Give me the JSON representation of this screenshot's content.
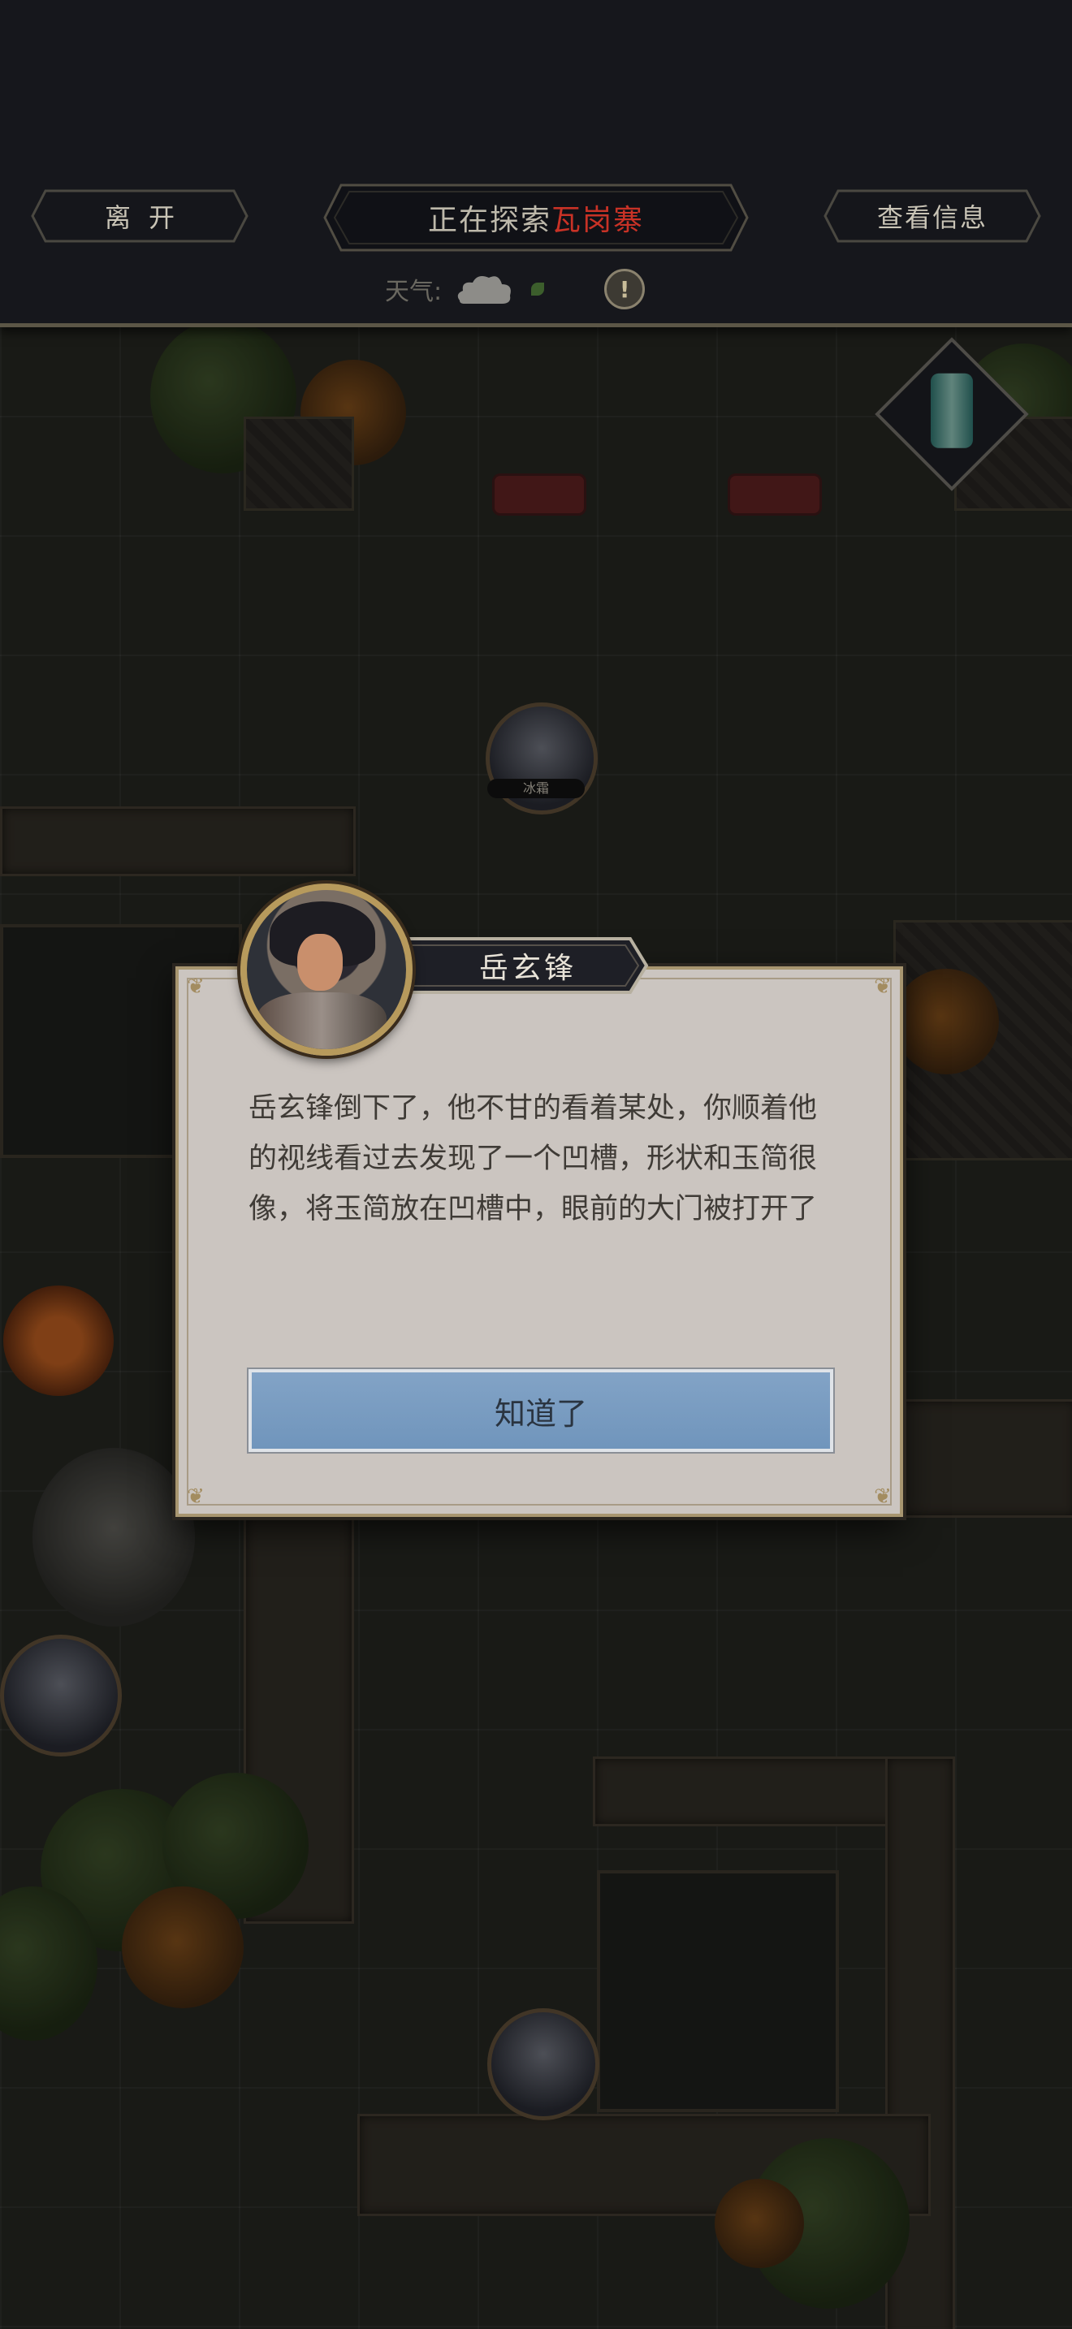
{
  "topbar": {
    "leave_label": "离开",
    "explore_prefix": "正在探索",
    "explore_place": "瓦岗寨",
    "info_label": "查看信息",
    "weather_label": "天气:",
    "warning_glyph": "!"
  },
  "map": {
    "npc_tokens": [
      {
        "name": "冰霜"
      }
    ]
  },
  "dialog": {
    "speaker": "岳玄锋",
    "message": "岳玄锋倒下了，他不甘的看着某处，你顺着他的视线看过去发现了一个凹槽，形状和玉简很像，将玉简放在凹槽中，眼前的大门被打开了",
    "ok_label": "知道了"
  },
  "colors": {
    "accent_place": "#c83226",
    "ok_button": "#7b9dc2",
    "dialog_bg": "#cbc5c0",
    "topbar_bg": "#16171c"
  },
  "icons": {
    "weather": "cloud-icon",
    "warning": "warning-icon",
    "item": "jade-scroll-icon"
  }
}
